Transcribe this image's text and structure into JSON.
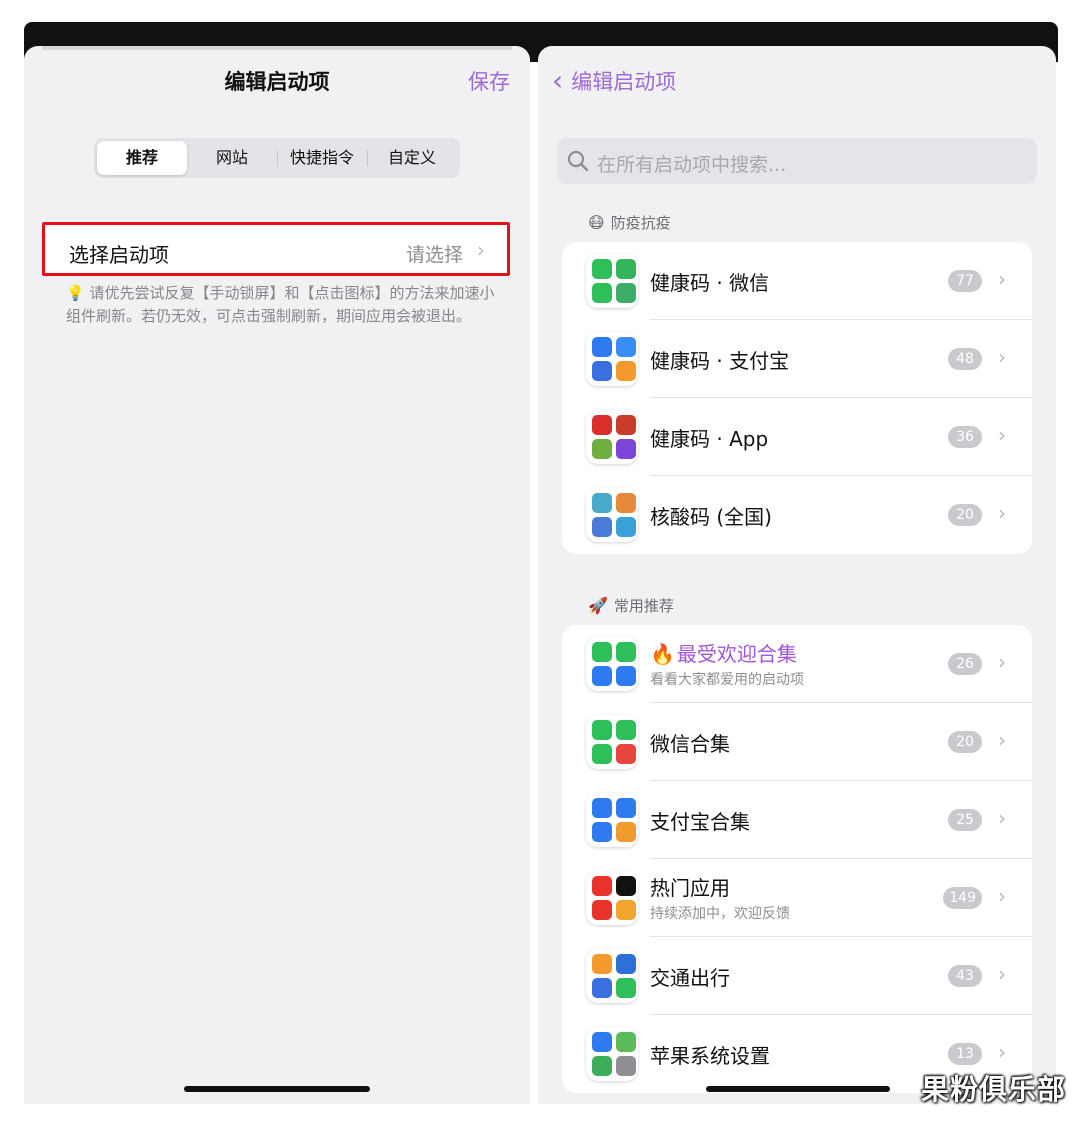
{
  "left": {
    "title": "编辑启动项",
    "save_label": "保存",
    "tabs": [
      "推荐",
      "网站",
      "快捷指令",
      "自定义"
    ],
    "select_row": {
      "label": "选择启动项",
      "value": "请选择"
    },
    "hint_icon": "lightbulb-icon",
    "hint_text": "请优先尝试反复【手动锁屏】和【点击图标】的方法来加速小组件刷新。若仍无效，可点击强制刷新，期间应用会被退出。"
  },
  "right": {
    "back_label": "编辑启动项",
    "search_placeholder": "在所有启动项中搜索...",
    "sections": [
      {
        "title": "防疫抗疫",
        "icon": "mask-face-icon",
        "emoji": "😷",
        "items": [
          {
            "title": "健康码 · 微信",
            "count": "77",
            "icon_colors": [
              "#2fbf5a",
              "#34b45c",
              "#2fbf5a",
              "#3cae6a"
            ]
          },
          {
            "title": "健康码 · 支付宝",
            "count": "48",
            "icon_colors": [
              "#2e7bf0",
              "#3a8df5",
              "#3a6fe0",
              "#f29a2e"
            ]
          },
          {
            "title": "健康码 · App",
            "count": "36",
            "icon_colors": [
              "#d9302c",
              "#c93b2b",
              "#6fae3f",
              "#7a45d8"
            ]
          },
          {
            "title": "核酸码 (全国)",
            "count": "20",
            "icon_colors": [
              "#49a9c9",
              "#e58a3b",
              "#4a7bd8",
              "#3aa0d8"
            ]
          }
        ]
      },
      {
        "title": "常用推荐",
        "icon": "rocket-icon",
        "emoji": "🚀",
        "items": [
          {
            "title": "最受欢迎合集",
            "subtitle": "看看大家都爱用的启动项",
            "count": "26",
            "hot": true,
            "icon_colors": [
              "#2fbf5a",
              "#2fbf5a",
              "#2e7bf0",
              "#2e7bf0"
            ]
          },
          {
            "title": "微信合集",
            "count": "20",
            "icon_colors": [
              "#2fbf5a",
              "#2fbf5a",
              "#2fbf5a",
              "#e8453c"
            ]
          },
          {
            "title": "支付宝合集",
            "count": "25",
            "icon_colors": [
              "#2e7bf0",
              "#2e7bf0",
              "#2e7bf0",
              "#f29a2e"
            ]
          },
          {
            "title": "热门应用",
            "subtitle": "持续添加中，欢迎反馈",
            "count": "149",
            "icon_colors": [
              "#e8332c",
              "#111111",
              "#e8332c",
              "#f2a52e"
            ]
          },
          {
            "title": "交通出行",
            "count": "43",
            "icon_colors": [
              "#f29a2e",
              "#2e6fd8",
              "#3a6fe0",
              "#2fbf5a"
            ]
          },
          {
            "title": "苹果系统设置",
            "count": "13",
            "icon_colors": [
              "#2e7bf0",
              "#5cbc5c",
              "#3cae5a",
              "#8e8e93"
            ]
          }
        ]
      }
    ]
  },
  "watermark": "果粉俱乐部",
  "colors": {
    "accent": "#9b6bd6",
    "highlight_border": "#e0111b",
    "badge": "#c9c9ce"
  }
}
